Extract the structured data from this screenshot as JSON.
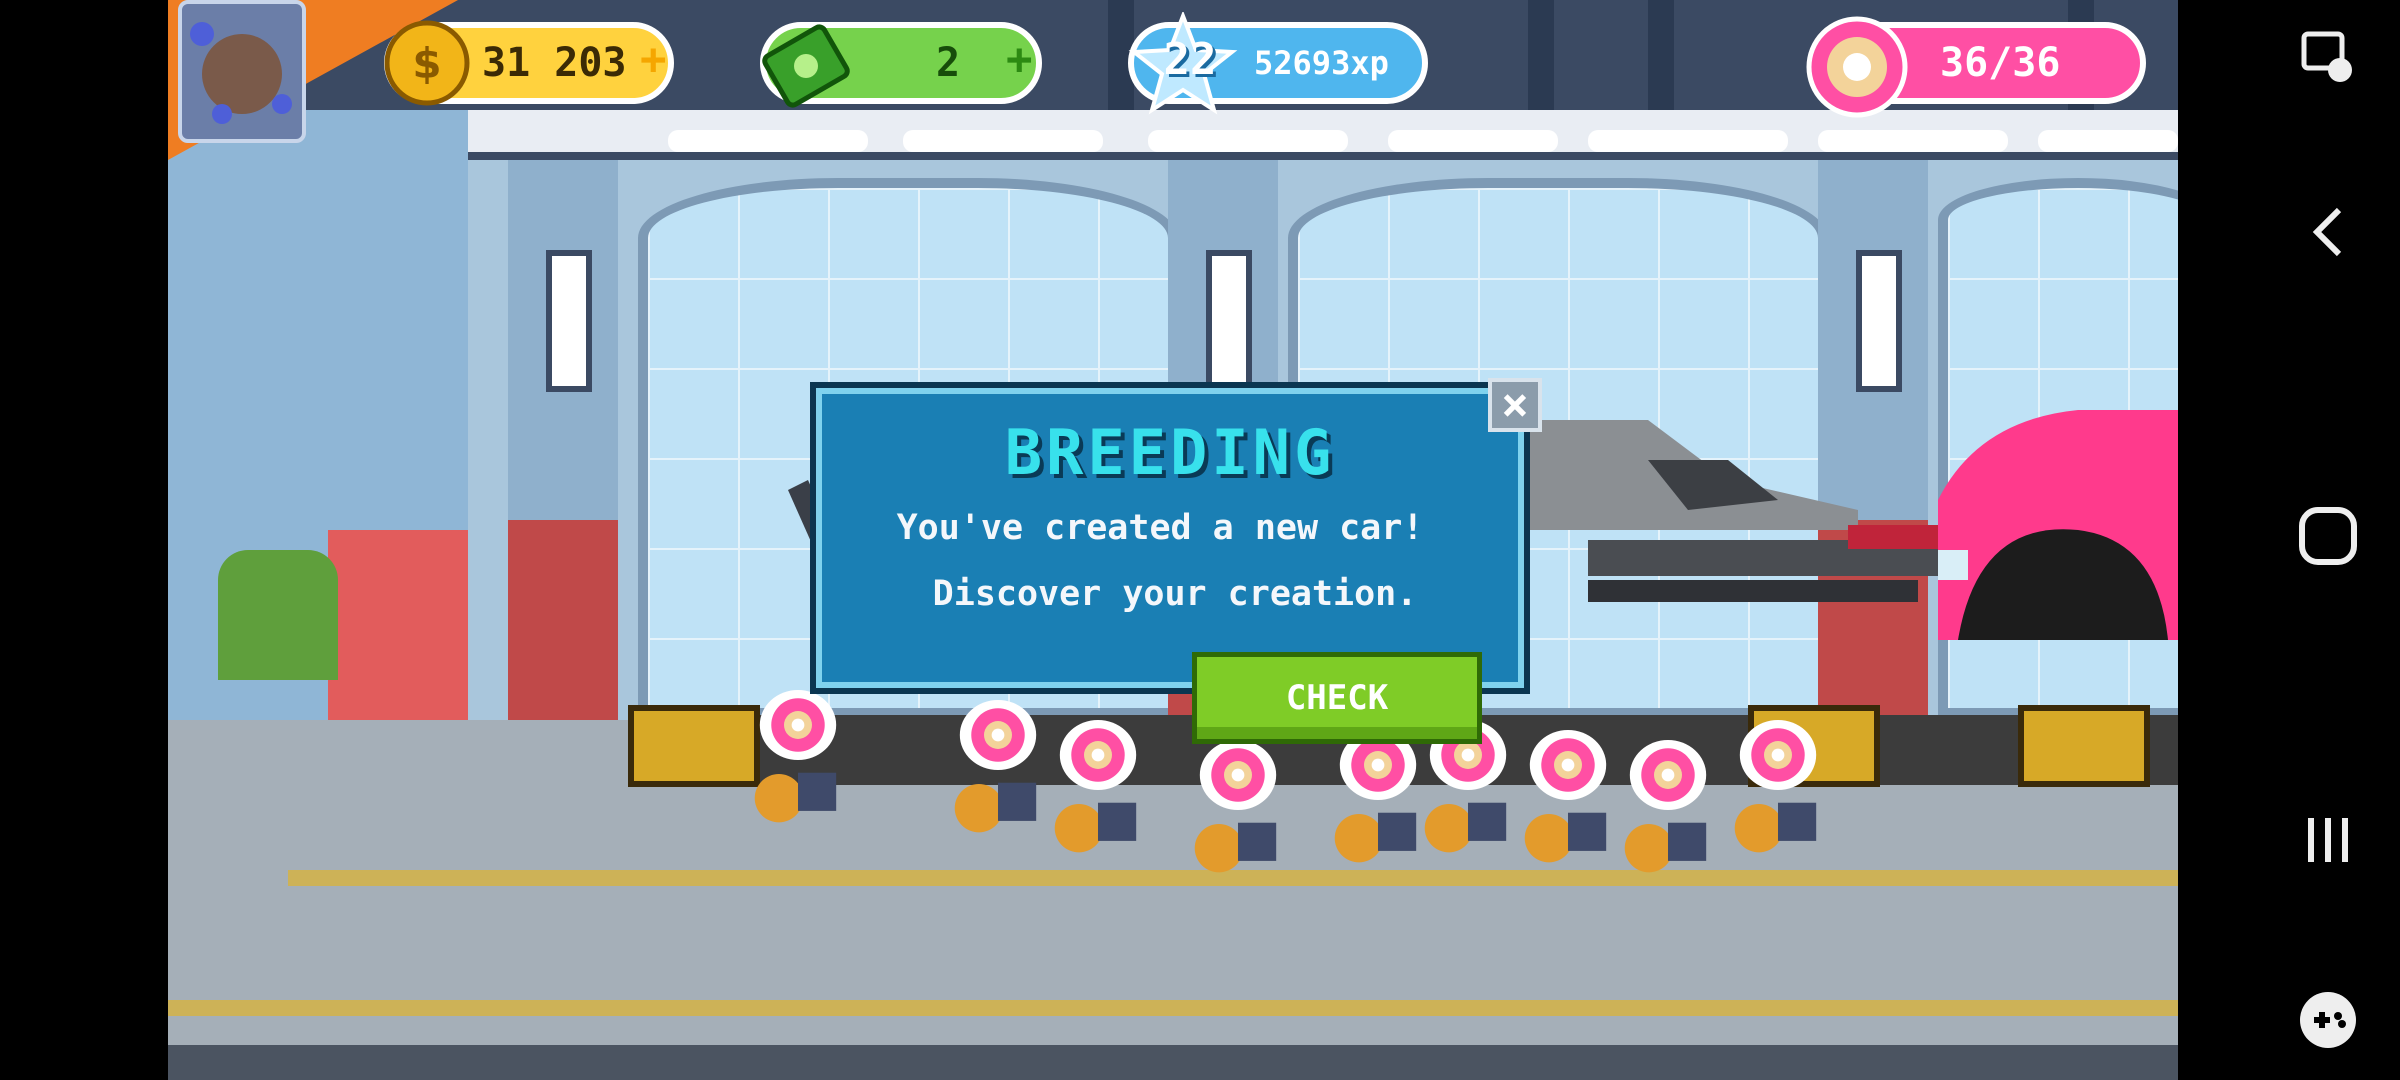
{
  "hud": {
    "coins": "31 203",
    "cash": "2",
    "xp_level": "22",
    "xp_points": "52693xp",
    "donuts": "36/36"
  },
  "dialog": {
    "title": "BREEDING",
    "message_line1": "You've created a new car!",
    "message_line2": "Discover your creation.",
    "close_symbol": "×",
    "check_label": "CHECK"
  },
  "system_nav": {
    "icons": [
      "screenshot-edit-icon",
      "back-icon",
      "home-icon",
      "recents-icon",
      "game-tools-icon"
    ]
  },
  "colors": {
    "dialog_bg": "#1a7fb4",
    "title": "#38e1ec",
    "check_button": "#7fcc27",
    "donut_pill": "#ff4fa4",
    "coin_pill": "#ffd23e",
    "cash_pill": "#76d24c",
    "xp_pill": "#4fb6ee"
  }
}
